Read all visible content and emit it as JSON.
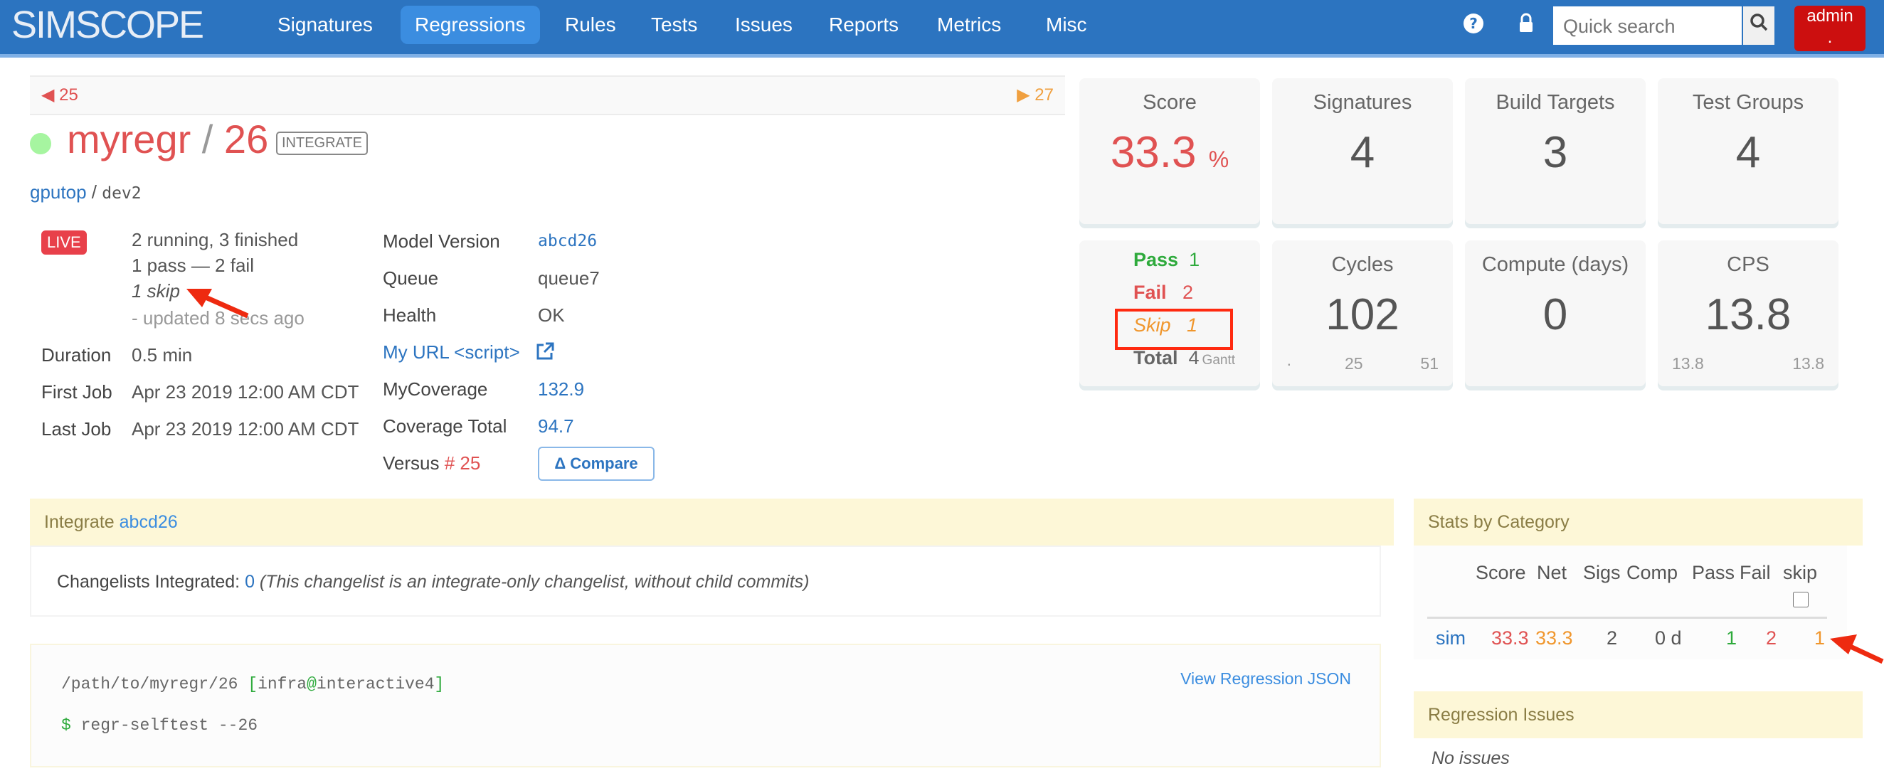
{
  "nav": {
    "brand": "SIMSCOPE",
    "items": [
      {
        "label": "Signatures",
        "active": false
      },
      {
        "label": "Regressions",
        "active": true
      },
      {
        "label": "Rules",
        "active": false
      },
      {
        "label": "Tests",
        "active": false
      },
      {
        "label": "Issues",
        "active": false
      },
      {
        "label": "Reports",
        "active": false
      },
      {
        "label": "Metrics",
        "active": false
      },
      {
        "label": "Misc",
        "active": false
      }
    ],
    "search_placeholder": "Quick search",
    "user_label": "admin",
    "user_sub": "."
  },
  "pager": {
    "prev": "25",
    "next": "27"
  },
  "header": {
    "name": "myregr",
    "separator": "/",
    "number": "26",
    "badge": "INTEGRATE",
    "project": "gputop",
    "branch_sep": "/",
    "branch": "dev2"
  },
  "status": {
    "live_label": "LIVE",
    "running": "2 running, 3 finished",
    "pass_fail": "1 pass — 2 fail",
    "skip": "1 skip",
    "updated": "- updated 8 secs ago"
  },
  "details_left": [
    {
      "label": "Duration",
      "value": "0.5 min"
    },
    {
      "label": "First Job",
      "value": "Apr 23 2019 12:00 AM CDT"
    },
    {
      "label": "Last Job",
      "value": "Apr 23 2019 12:00 AM CDT"
    }
  ],
  "details_right": {
    "model_version_label": "Model Version",
    "model_version": "abcd26",
    "queue_label": "Queue",
    "queue": "queue7",
    "health_label": "Health",
    "health": "OK",
    "url_label": "My URL <script>",
    "mycoverage_label": "MyCoverage",
    "mycoverage": "132.9",
    "coverage_total_label": "Coverage Total",
    "coverage_total": "94.7",
    "versus_label": "Versus",
    "versus_value": "# 25",
    "compare_label": "Δ Compare"
  },
  "cards": {
    "score": {
      "title": "Score",
      "value": "33.3",
      "unit": "%"
    },
    "signatures": {
      "title": "Signatures",
      "value": "4"
    },
    "build_targets": {
      "title": "Build Targets",
      "value": "3"
    },
    "test_groups": {
      "title": "Test Groups",
      "value": "4"
    },
    "results": {
      "pass_label": "Pass",
      "pass": "1",
      "fail_label": "Fail",
      "fail": "2",
      "skip_label": "Skip",
      "skip": "1",
      "total_label": "Total",
      "total": "4",
      "gantt": "Gantt"
    },
    "cycles": {
      "title": "Cycles",
      "value": "102",
      "min": "·",
      "mid": "25",
      "max": "51"
    },
    "compute": {
      "title": "Compute (days)",
      "value": "0"
    },
    "cps": {
      "title": "CPS",
      "value": "13.8",
      "min": "13.8",
      "max": "13.8"
    }
  },
  "integrate": {
    "title": "Integrate",
    "link": "abcd26",
    "cl_label": "Changelists Integrated:",
    "cl_count": "0",
    "cl_note": "(This changelist is an integrate-only changelist, without child commits)"
  },
  "console": {
    "path": "/path/to/myregr/26",
    "host_open": "[",
    "user": "infra",
    "at": "@",
    "host": "interactive4",
    "host_close": "]",
    "prompt": "$",
    "command": "regr-selftest --26",
    "json_link": "View Regression JSON"
  },
  "stats": {
    "title": "Stats by Category",
    "headers": [
      "Score",
      "Net",
      "Sigs",
      "Comp",
      "Pass",
      "Fail",
      "skip"
    ],
    "rows": [
      {
        "category": "sim",
        "score": "33.3",
        "net": "33.3",
        "sigs": "2",
        "comp": "0 d",
        "pass": "1",
        "fail": "2",
        "skip": "1"
      }
    ],
    "skip_checkbox_checked": false
  },
  "issues": {
    "title": "Regression Issues",
    "empty": "No issues"
  },
  "colors": {
    "nav": "#2c74c0",
    "accent_red": "#e05252",
    "pass_green": "#2eaa3c",
    "skip_orange": "#f0962c",
    "panel_yellow": "#fdf7d7"
  }
}
